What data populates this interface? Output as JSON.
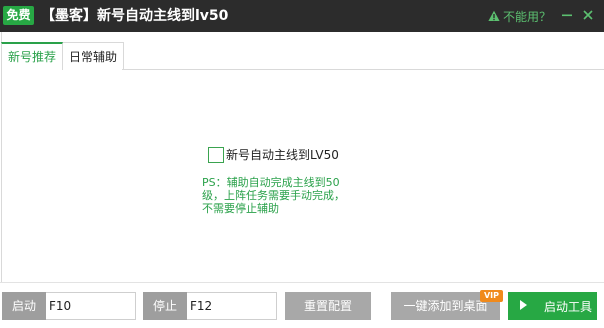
{
  "titlebar": {
    "free_badge": "免费",
    "title": "【墨客】新号自动主线到lv50",
    "help_text": "不能用？"
  },
  "tabs": [
    {
      "label": "新号推荐",
      "active": true
    },
    {
      "label": "日常辅助",
      "active": false
    }
  ],
  "main": {
    "option_label": "新号自动主线到LV50",
    "option_checked": false,
    "ps_note": "PS：辅助自动完成主线到50\n级，上阵任务需要手动完成，\n不需要停止辅助"
  },
  "bottom": {
    "start_label": "启动",
    "start_hotkey": "F10",
    "stop_label": "停止",
    "stop_hotkey": "F12",
    "reset_label": "重置配置",
    "add_desktop_label": "一键添加到桌面",
    "vip_badge": "VIP",
    "launch_label": "启动工具"
  },
  "colors": {
    "accent": "#27a844",
    "titlebar": "#2c2c2c",
    "button_gray": "#a8a8a8",
    "vip": "#f08a1c"
  },
  "icons": {
    "help": "warning-icon",
    "minimize": "minimize-icon",
    "close": "close-icon",
    "launch": "play-icon"
  }
}
